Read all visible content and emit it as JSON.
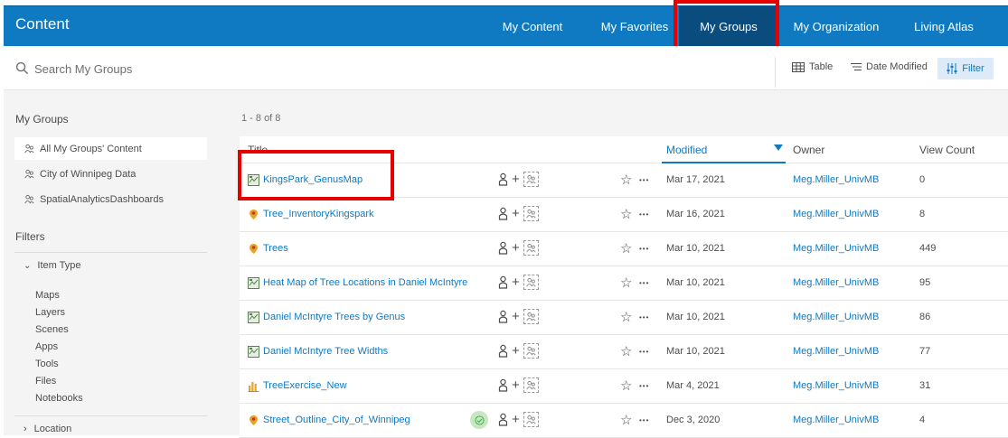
{
  "app_title": "Content",
  "nav": [
    "My Content",
    "My Favorites",
    "My Groups",
    "My Organization",
    "Living Atlas"
  ],
  "active_nav": "My Groups",
  "search": {
    "placeholder": "Search My Groups"
  },
  "toolbar": {
    "table": "Table",
    "sort": "Date Modified",
    "filter": "Filter"
  },
  "sidebar": {
    "groups_heading": "My Groups",
    "groups": [
      "All My Groups' Content",
      "City of Winnipeg Data",
      "SpatialAnalyticsDashboards"
    ],
    "filters_heading": "Filters",
    "item_type_label": "Item Type",
    "item_types": [
      "Maps",
      "Layers",
      "Scenes",
      "Apps",
      "Tools",
      "Files",
      "Notebooks"
    ],
    "location_label": "Location"
  },
  "result_count": "1 - 8 of 8",
  "table": {
    "columns": {
      "title": "Title",
      "modified": "Modified",
      "owner": "Owner",
      "views": "View Count"
    },
    "rows": [
      {
        "title": "KingsPark_GenusMap",
        "type": "web-map-icon",
        "modified": "Mar 17, 2021",
        "owner": "Meg.Miller_UnivMB",
        "views": "0",
        "verified": false
      },
      {
        "title": "Tree_InventoryKingspark",
        "type": "layer-icon",
        "modified": "Mar 16, 2021",
        "owner": "Meg.Miller_UnivMB",
        "views": "8",
        "verified": false
      },
      {
        "title": "Trees",
        "type": "layer-icon",
        "modified": "Mar 10, 2021",
        "owner": "Meg.Miller_UnivMB",
        "views": "449",
        "verified": false
      },
      {
        "title": "Heat Map of Tree Locations in Daniel McIntyre",
        "type": "web-map-icon",
        "modified": "Mar 10, 2021",
        "owner": "Meg.Miller_UnivMB",
        "views": "95",
        "verified": false
      },
      {
        "title": "Daniel McIntyre Trees by Genus",
        "type": "web-map-icon",
        "modified": "Mar 10, 2021",
        "owner": "Meg.Miller_UnivMB",
        "views": "86",
        "verified": false
      },
      {
        "title": "Daniel McIntyre Tree Widths",
        "type": "web-map-icon",
        "modified": "Mar 10, 2021",
        "owner": "Meg.Miller_UnivMB",
        "views": "77",
        "verified": false
      },
      {
        "title": "TreeExercise_New",
        "type": "dashboard-icon",
        "modified": "Mar 4, 2021",
        "owner": "Meg.Miller_UnivMB",
        "views": "31",
        "verified": false
      },
      {
        "title": "Street_Outline_City_of_Winnipeg",
        "type": "layer-icon",
        "modified": "Dec 3, 2020",
        "owner": "Meg.Miller_UnivMB",
        "views": "4",
        "verified": true
      }
    ]
  },
  "colors": {
    "header": "#0f79c1",
    "active_tab": "#0a4c7e",
    "link": "#0f79c1",
    "highlight": "#e60000"
  }
}
